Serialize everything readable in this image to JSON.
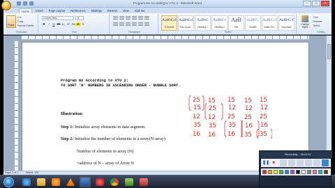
{
  "titlebar": {
    "title": "Program No According to VTU 2 - Microsoft Word"
  },
  "tabs": [
    "Home",
    "Insert",
    "Page Layout",
    "References",
    "Mailings",
    "Review",
    "View",
    "Add-Ins"
  ],
  "clipboard": {
    "paste": "Paste",
    "cut": "Cut",
    "copy": "Copy",
    "format_painter": "Format Painter",
    "label": "Clipboard"
  },
  "font": {
    "name": "Courier New",
    "size": "11",
    "label": "Font"
  },
  "paragraph": {
    "label": "Paragraph"
  },
  "styles": {
    "label": "Styles",
    "tiles": [
      {
        "sample": "AaBbCcI",
        "name": "¶ Normal"
      },
      {
        "sample": "AaBbCcI",
        "name": "¶ No Spaci..."
      },
      {
        "sample": "AaBbC",
        "name": "Heading 1"
      },
      {
        "sample": "AaBbCc",
        "name": "Heading 2"
      },
      {
        "sample": "AaB",
        "name": "Title"
      },
      {
        "sample": "AaBbCc",
        "name": "Subtitle"
      },
      {
        "sample": "AaBbCcI",
        "name": "Subtle Em..."
      },
      {
        "sample": "AaBbCcI",
        "name": "Emphasis"
      }
    ],
    "change_styles": "Change Styles"
  },
  "editing": {
    "find": "Find",
    "replace": "Replace",
    "select": "Select",
    "label": "Editing"
  },
  "document": {
    "program_line": "Program No According to VTU 2:",
    "sort_line": "TO SORT 'N' NUMBERS IN ASCENDING ORDER - BUBBLE SORT.",
    "illustration": "Illustration:",
    "step1_label": "Step 1:",
    "step1_text": " Initialize array elements in data segment.",
    "step2_label": "Step 2:",
    "step2_text": " Initialize the number of elements in a array(N-array)",
    "number_line": "Number of elements in array (N)",
    "address_line": "=address of N – array of Array N"
  },
  "handwriting": {
    "ink_color": "#d12a1e",
    "columns": [
      [
        "25",
        "15",
        "12",
        "35",
        "16"
      ],
      [
        "15",
        "25",
        "12",
        "35",
        "16"
      ],
      [
        "15",
        "12",
        "25",
        "35",
        "16"
      ],
      [
        "15",
        "12",
        "25",
        "16",
        "35"
      ],
      [
        "15",
        "12",
        "25",
        "16",
        "35"
      ]
    ]
  },
  "statusbar": {
    "page": "Page: 1 of 1",
    "words": "Words: 126"
  },
  "recorder": {
    "title": "Recording... 00:02:17",
    "swatch_colors": [
      "#ff2222",
      "#ff9900",
      "#ffff00",
      "#22cc22",
      "#2288ff",
      "#aa44ff",
      "#000000",
      "#ffffff",
      "#888888",
      "#ff66cc",
      "#00cccc",
      "#663300"
    ]
  }
}
